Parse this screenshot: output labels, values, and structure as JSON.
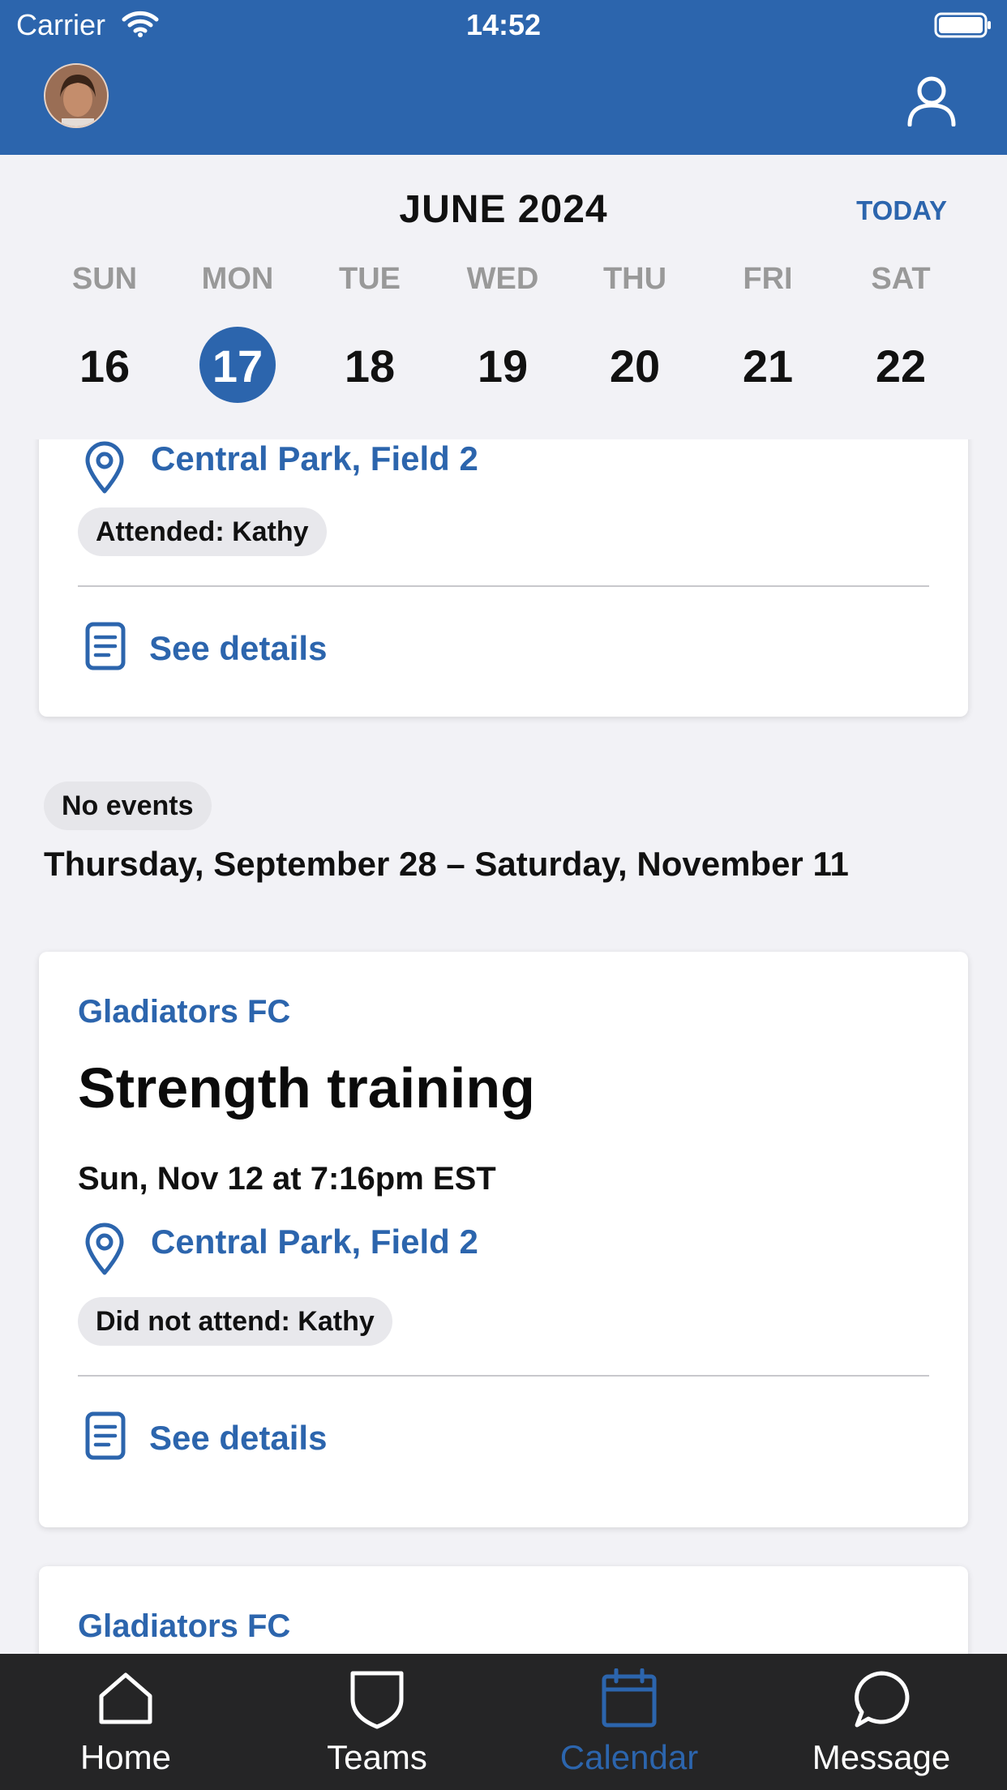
{
  "status_bar": {
    "carrier": "Carrier",
    "time": "14:52"
  },
  "header": {
    "avatar": "avatar",
    "profile_icon": "person-icon"
  },
  "calendar": {
    "month_title": "JUNE 2024",
    "today_label": "TODAY",
    "weekdays": [
      "SUN",
      "MON",
      "TUE",
      "WED",
      "THU",
      "FRI",
      "SAT"
    ],
    "days": [
      "16",
      "17",
      "18",
      "19",
      "20",
      "21",
      "22"
    ],
    "selected_day": "17"
  },
  "card1": {
    "location": "Central Park, Field 2",
    "attendance": "Attended: Kathy",
    "details_label": "See details"
  },
  "no_events": {
    "badge": "No events",
    "range": "Thursday, September 28 – Saturday, November 11"
  },
  "card2": {
    "team": "Gladiators FC",
    "title": "Strength training",
    "time": "Sun, Nov 12 at 7:16pm EST",
    "location": "Central Park, Field 2",
    "attendance": "Did not attend: Kathy",
    "details_label": "See details"
  },
  "card3": {
    "team": "Gladiators FC"
  },
  "tabs": [
    {
      "label": "Home",
      "icon": "home-icon",
      "active": false
    },
    {
      "label": "Teams",
      "icon": "shield-icon",
      "active": false
    },
    {
      "label": "Calendar",
      "icon": "calendar-icon",
      "active": true
    },
    {
      "label": "Message",
      "icon": "chat-bubble-icon",
      "active": false
    }
  ],
  "colors": {
    "brand": "#2c65ad",
    "tab_bar": "#252526",
    "background": "#f2f2f6"
  }
}
